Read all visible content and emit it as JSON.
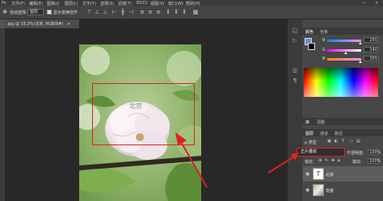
{
  "menubar": {
    "items": [
      "Ps",
      "文件(F)",
      "编辑(E)",
      "图像(I)",
      "图层(L)",
      "文字(Y)",
      "选择(S)",
      "滤镜(T)",
      "3D(D)",
      "视图(V)",
      "窗口(W)",
      "帮助(H)"
    ],
    "minimize": "—",
    "close": "×"
  },
  "options": {
    "auto_select_label": "自动选择:",
    "layer_select_value": "图层",
    "show_transform_label": "显示变换控件"
  },
  "document": {
    "tab_title": ".jpg @ 33.3%(北京, RGB/8#)",
    "tab_close": "×",
    "canvas_text": "北京"
  },
  "color_panel": {
    "tabs": [
      "颜色",
      "色板"
    ],
    "sliders": [
      {
        "label": "R",
        "value": "255",
        "fraction": 0.98
      },
      {
        "label": "G",
        "value": "140",
        "fraction": 0.55
      },
      {
        "label": "B",
        "value": "255",
        "fraction": 0.98
      }
    ]
  },
  "mid_tabs": {
    "library": "库",
    "adjust": "调整"
  },
  "layers_panel": {
    "tabs": [
      "图层",
      "通道",
      "路径"
    ],
    "kind_label": "ρ 类型",
    "blend_mode": "正片叠底",
    "opacity_label": "不透明度:",
    "opacity_value": "100%",
    "lock_label": "锁定:",
    "fill_label": "填充:",
    "fill_value": "100%",
    "layers": [
      {
        "name": "北京",
        "type": "text"
      },
      {
        "name": "背景",
        "type": "image"
      }
    ]
  },
  "colors": {
    "accent_red": "#e02020",
    "fg_swatch": "#5b8fd8",
    "bg_swatch": "#000000"
  }
}
